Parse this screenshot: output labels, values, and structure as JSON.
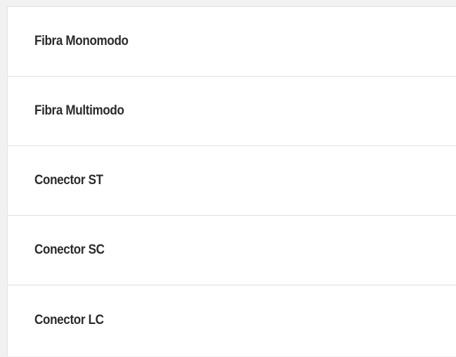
{
  "list": {
    "items": [
      {
        "label": "Fibra Monomodo"
      },
      {
        "label": "Fibra Multimodo"
      },
      {
        "label": "Conector ST"
      },
      {
        "label": "Conector SC"
      },
      {
        "label": "Conector LC"
      }
    ]
  }
}
